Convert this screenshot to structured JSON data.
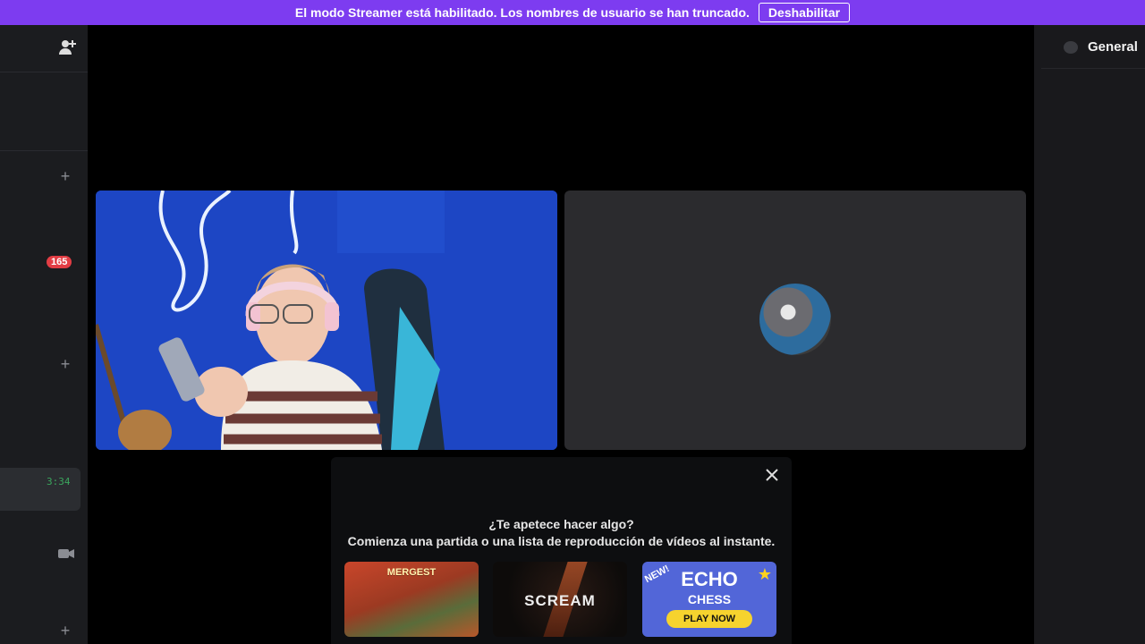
{
  "banner": {
    "message": "El modo Streamer está habilitado. Los nombres de usuario se han truncado.",
    "button": "Deshabilitar"
  },
  "left_panel": {
    "badge_count": "165",
    "timer": "3:34"
  },
  "voice": {
    "participants": [
      {
        "type": "camera"
      },
      {
        "type": "avatar"
      }
    ]
  },
  "activity": {
    "question": "¿Te apetece hacer algo?",
    "subtitle": "Comienza una partida o una lista de reproducción de vídeos al instante.",
    "cards": [
      {
        "title": "MERGEST"
      },
      {
        "title": "SCREAM"
      },
      {
        "badge": "NEW!",
        "title": "ECHO",
        "title2": "CHESS",
        "cta": "PLAY NOW"
      }
    ]
  },
  "right_panel": {
    "channel": "General"
  },
  "colors": {
    "banner": "#7d3cf0",
    "badge": "#e23d44",
    "timer": "#3ba55d"
  }
}
